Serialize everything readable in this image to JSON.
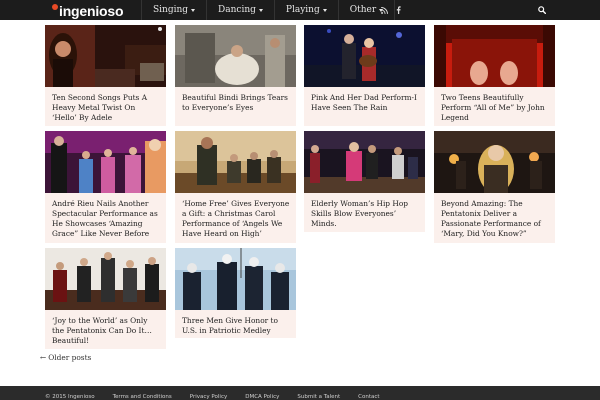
{
  "header": {
    "logo_text": "ingenioso",
    "nav": [
      {
        "label": "Singing"
      },
      {
        "label": "Dancing"
      },
      {
        "label": "Playing"
      },
      {
        "label": "Other"
      }
    ],
    "social_icons": [
      "rss-icon",
      "facebook-icon"
    ],
    "search_icon": "search-icon",
    "colors": {
      "bar": "#1c1c1c",
      "logo_accent": "#e84a26",
      "card_bg": "#fbf0ec"
    }
  },
  "posts": [
    {
      "title": "Ten Second Songs Puts A Heavy Metal Twist On ‘Hello’ By Adele"
    },
    {
      "title": "Beautiful Bindi Brings Tears to Everyone’s Eyes"
    },
    {
      "title": "Pink And Her Dad Perform-I Have Seen The Rain"
    },
    {
      "title": "Two Teens Beautifully Perform “All of Me” by John Legend"
    },
    {
      "title": "André Rieu Nails Another Spectacular Performance as He Showcases ‘Amazing Grace” Like Never Before"
    },
    {
      "title": "‘Home Free’ Gives Everyone a Gift: a Christmas Carol Performance of ‘Angels We Have Heard on High’"
    },
    {
      "title": "Elderly Woman’s Hip Hop Skills Blow Everyones’ Minds."
    },
    {
      "title": "Beyond Amazing: The Pentatonix Deliver a Passionate Performance of ‘Mary, Did You Know?”"
    },
    {
      "title": "‘Joy to the World’ as Only the Pentatonix Can Do It… Beautiful!"
    },
    {
      "title": "Three Men Give Honor to U.S. in Patriotic Medley"
    }
  ],
  "pagination": {
    "arrow": "←",
    "label": "Older posts"
  },
  "footer": {
    "copyright": "© 2015 Ingenioso",
    "links": [
      "Terms and Conditions",
      "Privacy Policy",
      "DMCA Policy",
      "Submit a Talent",
      "Contact"
    ]
  }
}
